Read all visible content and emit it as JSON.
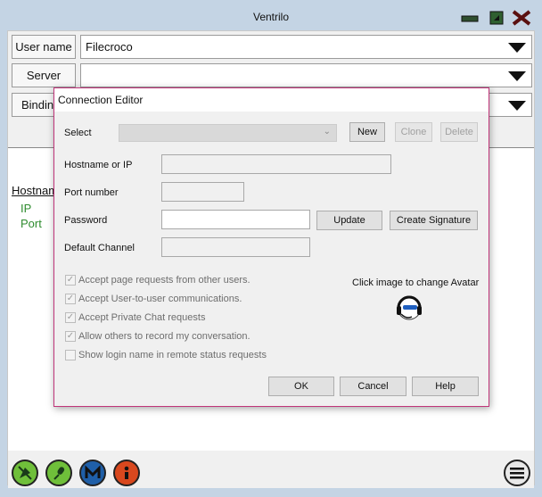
{
  "window": {
    "title": "Ventrilo",
    "accent": "#c4d4e4"
  },
  "main": {
    "username_label": "User name",
    "username_value": "Filecroco",
    "server_label": "Server",
    "server_value": "",
    "binding_label": "Bindin",
    "binding_value": "",
    "tree": {
      "header": "Hostnam",
      "items": [
        "IP",
        "Port"
      ]
    }
  },
  "bottom_icons": [
    "microphone-mute-icon",
    "microphone-icon",
    "m-logo-icon",
    "info-icon",
    "menu-icon"
  ],
  "dialog": {
    "title": "Connection Editor",
    "border_color": "#c0357a",
    "select_label": "Select",
    "select_value": "",
    "new_label": "New",
    "clone_label": "Clone",
    "delete_label": "Delete",
    "hostname_label": "Hostname or IP",
    "hostname_value": "",
    "port_label": "Port number",
    "port_value": "",
    "password_label": "Password",
    "password_value": "",
    "update_label": "Update",
    "create_signature_label": "Create Signature",
    "default_channel_label": "Default Channel",
    "default_channel_value": "",
    "checkboxes": [
      {
        "label": "Accept page requests from other users.",
        "checked": true
      },
      {
        "label": "Accept User-to-user communications.",
        "checked": true
      },
      {
        "label": "Accept Private Chat requests",
        "checked": true
      },
      {
        "label": "Allow others to record my conversation.",
        "checked": true
      },
      {
        "label": "Show login name in remote status requests",
        "checked": false
      }
    ],
    "avatar_text": "Click image to change Avatar",
    "ok_label": "OK",
    "cancel_label": "Cancel",
    "help_label": "Help"
  }
}
